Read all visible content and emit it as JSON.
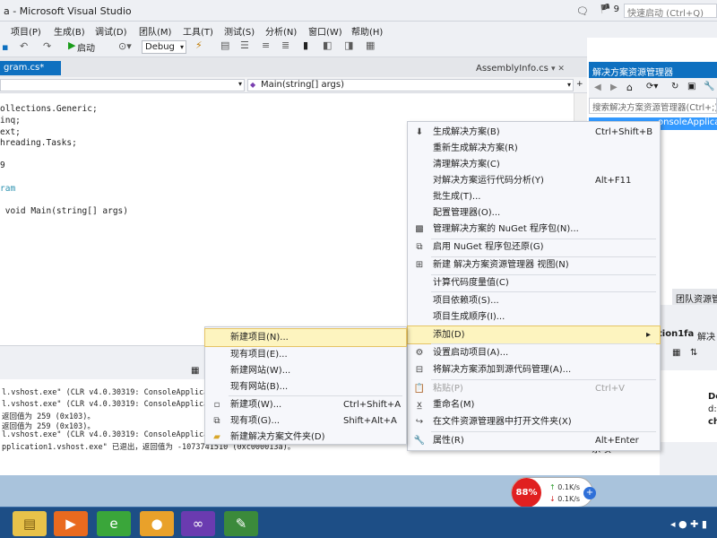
{
  "window": {
    "title": "a - Microsoft Visual Studio",
    "notifications": "9",
    "quick_launch_placeholder": "快速启动 (Ctrl+Q)"
  },
  "menubar": {
    "items": [
      "项目(P)",
      "生成(B)",
      "调试(D)",
      "团队(M)",
      "工具(T)",
      "测试(S)",
      "分析(N)",
      "窗口(W)",
      "帮助(H)"
    ]
  },
  "toolbar": {
    "start_label": "启动",
    "config_value": "Debug"
  },
  "editor": {
    "tabs": {
      "active": "gram.cs*",
      "other": "AssemblyInfo.cs"
    },
    "nav_member": "Main(string[] args)",
    "code_lines": [
      "ollections.Generic;",
      "inq;",
      "ext;",
      "hreading.Tasks;",
      "",
      "9",
      "",
      "ram",
      "",
      " void Main(string[] args)"
    ]
  },
  "output": {
    "lines": [
      "l.vshost.exe\" (CLR v4.0.30319: ConsoleApplication1.vshost.exe):",
      "l.vshost.exe\" (CLR v4.0.30319: ConsoleApplication1.vshost.exe):",
      "返回值为 259 (0x103)。",
      "返回值为 259 (0x103)。",
      "l.vshost.exe\" (CLR v4.0.30319: ConsoleApplication1.vshost.exe):",
      "pplication1.vshost.exe\" 已退出，返回值为 -1073741510 (0xc000013a)。"
    ]
  },
  "solution_explorer": {
    "title": "解决方案资源管理器",
    "search_placeholder": "搜索解决方案资源管理器(Ctrl+;)",
    "selected_item": "onsoleApplicati",
    "team_tab": "团队资源管",
    "partial_a": "tion1fa",
    "partial_a2": "解决",
    "partial_b": "De",
    "partial_c": "d:",
    "partial_d": "ch",
    "partial_text": "杂项"
  },
  "context_menu": {
    "items": [
      {
        "icon": "build-icon",
        "label": "生成解决方案(B)",
        "shortcut": "Ctrl+Shift+B"
      },
      {
        "label": "重新生成解决方案(R)"
      },
      {
        "label": "清理解决方案(C)"
      },
      {
        "label": "对解决方案运行代码分析(Y)",
        "shortcut": "Alt+F11"
      },
      {
        "label": "批生成(T)..."
      },
      {
        "label": "配置管理器(O)..."
      },
      {
        "icon": "nuget-icon",
        "label": "管理解决方案的 NuGet 程序包(N)..."
      },
      {
        "icon": "restore-icon",
        "label": "启用 NuGet 程序包还原(G)"
      },
      {
        "icon": "new-view-icon",
        "label": "新建 解决方案资源管理器 视图(N)"
      },
      {
        "label": "计算代码度量值(C)"
      },
      {
        "label": "项目依赖项(S)..."
      },
      {
        "label": "项目生成顺序(I)..."
      },
      {
        "label": "添加(D)",
        "arrow": "▸"
      },
      {
        "icon": "gear-icon",
        "label": "设置启动项目(A)..."
      },
      {
        "icon": "source-control-icon",
        "label": "将解决方案添加到源代码管理(A)..."
      },
      {
        "icon": "paste-icon",
        "label": "粘贴(P)",
        "shortcut": "Ctrl+V"
      },
      {
        "icon": "rename-icon",
        "label": "重命名(M)"
      },
      {
        "icon": "open-folder-icon",
        "label": "在文件资源管理器中打开文件夹(X)"
      },
      {
        "icon": "wrench-icon",
        "label": "属性(R)",
        "shortcut": "Alt+Enter"
      }
    ]
  },
  "submenu": {
    "items": [
      {
        "label": "新建项目(N)..."
      },
      {
        "label": "现有项目(E)..."
      },
      {
        "label": "新建网站(W)..."
      },
      {
        "label": "现有网站(B)..."
      },
      {
        "icon": "new-item-icon",
        "label": "新建项(W)...",
        "shortcut": "Ctrl+Shift+A"
      },
      {
        "icon": "existing-item-icon",
        "label": "现有项(G)...",
        "shortcut": "Shift+Alt+A"
      },
      {
        "icon": "folder-icon",
        "label": "新建解决方案文件夹(D)"
      }
    ]
  },
  "taskbar": {
    "cpu_percent": "88%",
    "upload_speed": "0.1K/s",
    "download_speed": "0.1K/s"
  }
}
